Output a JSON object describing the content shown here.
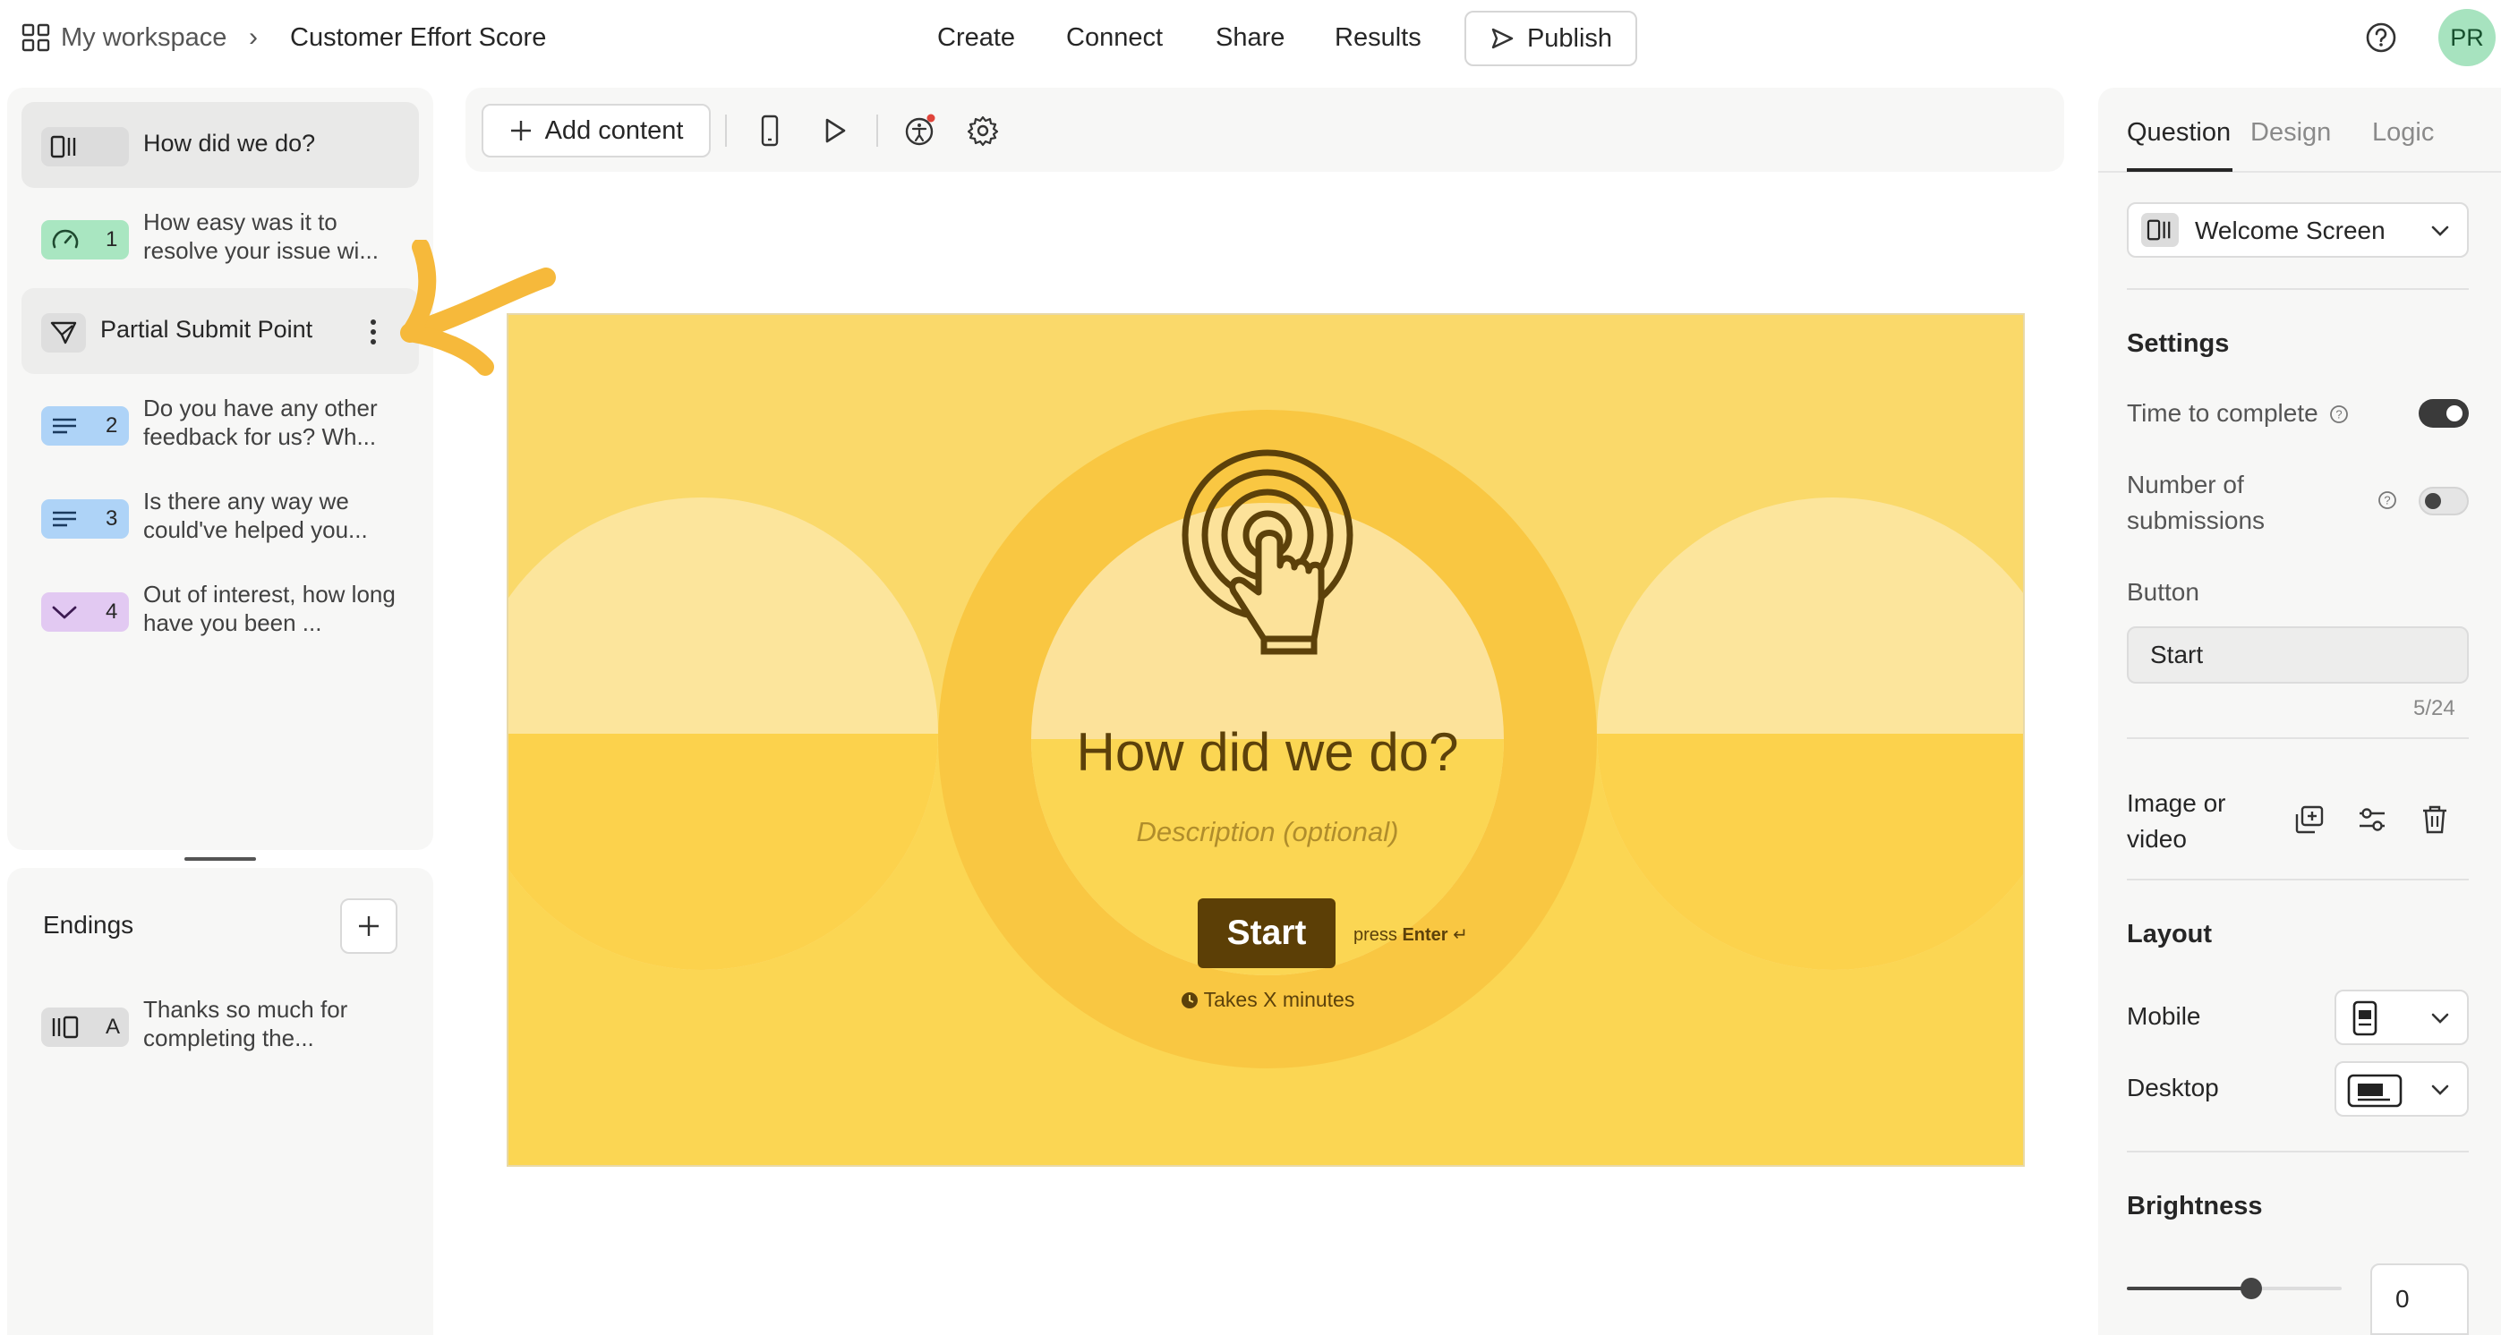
{
  "header": {
    "workspace": "My workspace",
    "form_title": "Customer Effort Score",
    "nav": [
      "Create",
      "Connect",
      "Share",
      "Results"
    ],
    "publish_label": "Publish",
    "avatar_initials": "PR"
  },
  "sidebar": {
    "questions": [
      {
        "text": "How did we do?",
        "badge_num": "",
        "icon": "welcome-screen-icon",
        "color": "#e2e2e2"
      },
      {
        "text": "How easy was it to resolve your issue wi...",
        "badge_num": "1",
        "icon": "gauge-icon",
        "color": "#a9e6c1"
      },
      {
        "text": "Partial Submit Point",
        "badge_num": "",
        "icon": "partial-submit-icon",
        "color": "#e2e2e2"
      },
      {
        "text": "Do you have any other feedback for us? Wh...",
        "badge_num": "2",
        "icon": "long-text-icon",
        "color": "#aed3f7"
      },
      {
        "text": "Is there any way we could've helped you...",
        "badge_num": "3",
        "icon": "long-text-icon",
        "color": "#aed3f7"
      },
      {
        "text": "Out of interest, how long have you been ...",
        "badge_num": "4",
        "icon": "dropdown-icon",
        "color": "#e2c9f2"
      }
    ],
    "endings_title": "Endings",
    "endings": [
      {
        "text": "Thanks so much for completing the...",
        "badge_num": "A",
        "icon": "ending-screen-icon",
        "color": "#e2e2e2"
      }
    ]
  },
  "toolbar": {
    "add_content_label": "Add content"
  },
  "canvas": {
    "title": "How did we do?",
    "description": "Description (optional)",
    "button_label": "Start",
    "press_prefix": "press",
    "press_key": "Enter",
    "enter_symbol": "↵",
    "takes": "Takes X minutes",
    "bg_color": "#fad96a",
    "button_color": "#5c3f06"
  },
  "right_panel": {
    "tabs": [
      "Question",
      "Design",
      "Logic"
    ],
    "type_label": "Welcome Screen",
    "settings_heading": "Settings",
    "time_to_complete_label": "Time to complete",
    "time_to_complete_on": true,
    "number_of_label": "Number of",
    "submissions_label": "submissions",
    "number_of_submissions_on": false,
    "button_heading": "Button",
    "button_value": "Start",
    "button_counter": "5/24",
    "image_label_1": "Image or",
    "image_label_2": "video",
    "layout_heading": "Layout",
    "mobile_label": "Mobile",
    "desktop_label": "Desktop",
    "brightness_heading": "Brightness",
    "brightness_value": "0",
    "brightness_fraction": 0.5
  },
  "annotation": {
    "arrow_color": "#f6b93b"
  }
}
